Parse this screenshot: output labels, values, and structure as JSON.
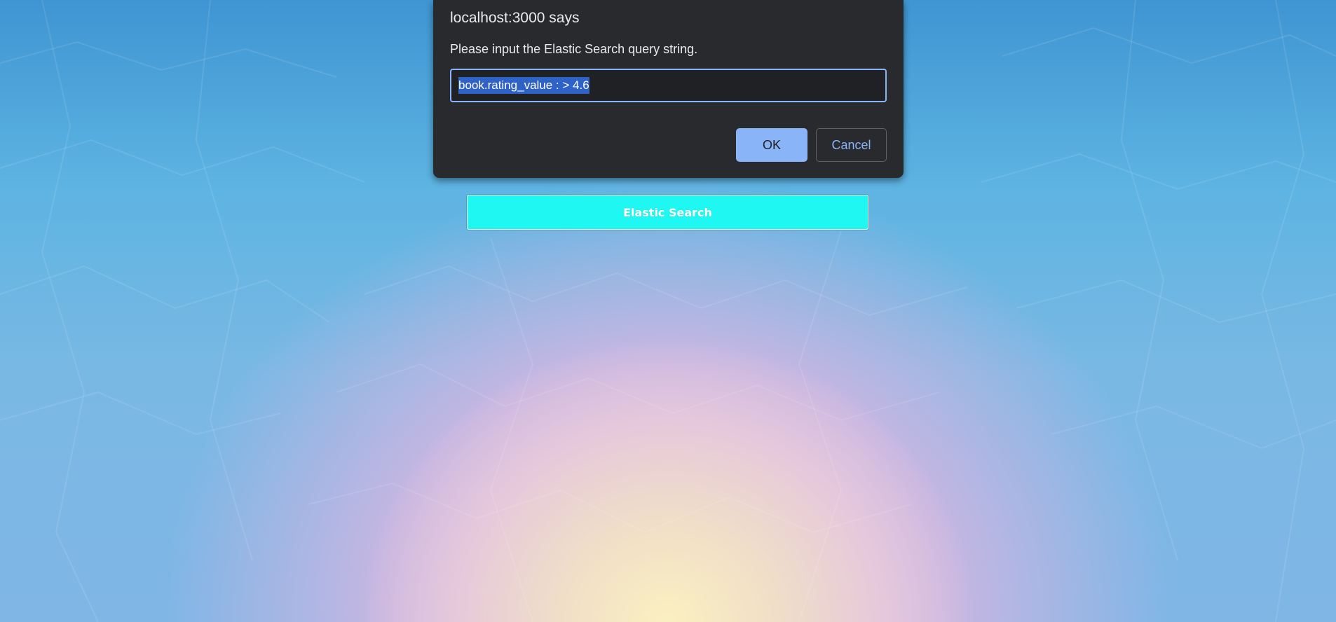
{
  "page": {
    "search_button_label": "Elastic Search",
    "colors": {
      "search_button": "#1ef7f2",
      "dialog_background": "#292a2d",
      "dialog_accent": "#8ab4f8",
      "selection_highlight": "#2f62c7"
    }
  },
  "dialog": {
    "title": "localhost:3000 says",
    "message": "Please input the Elastic Search query string.",
    "input_value": "book.rating_value : > 4.6",
    "ok_label": "OK",
    "cancel_label": "Cancel"
  }
}
